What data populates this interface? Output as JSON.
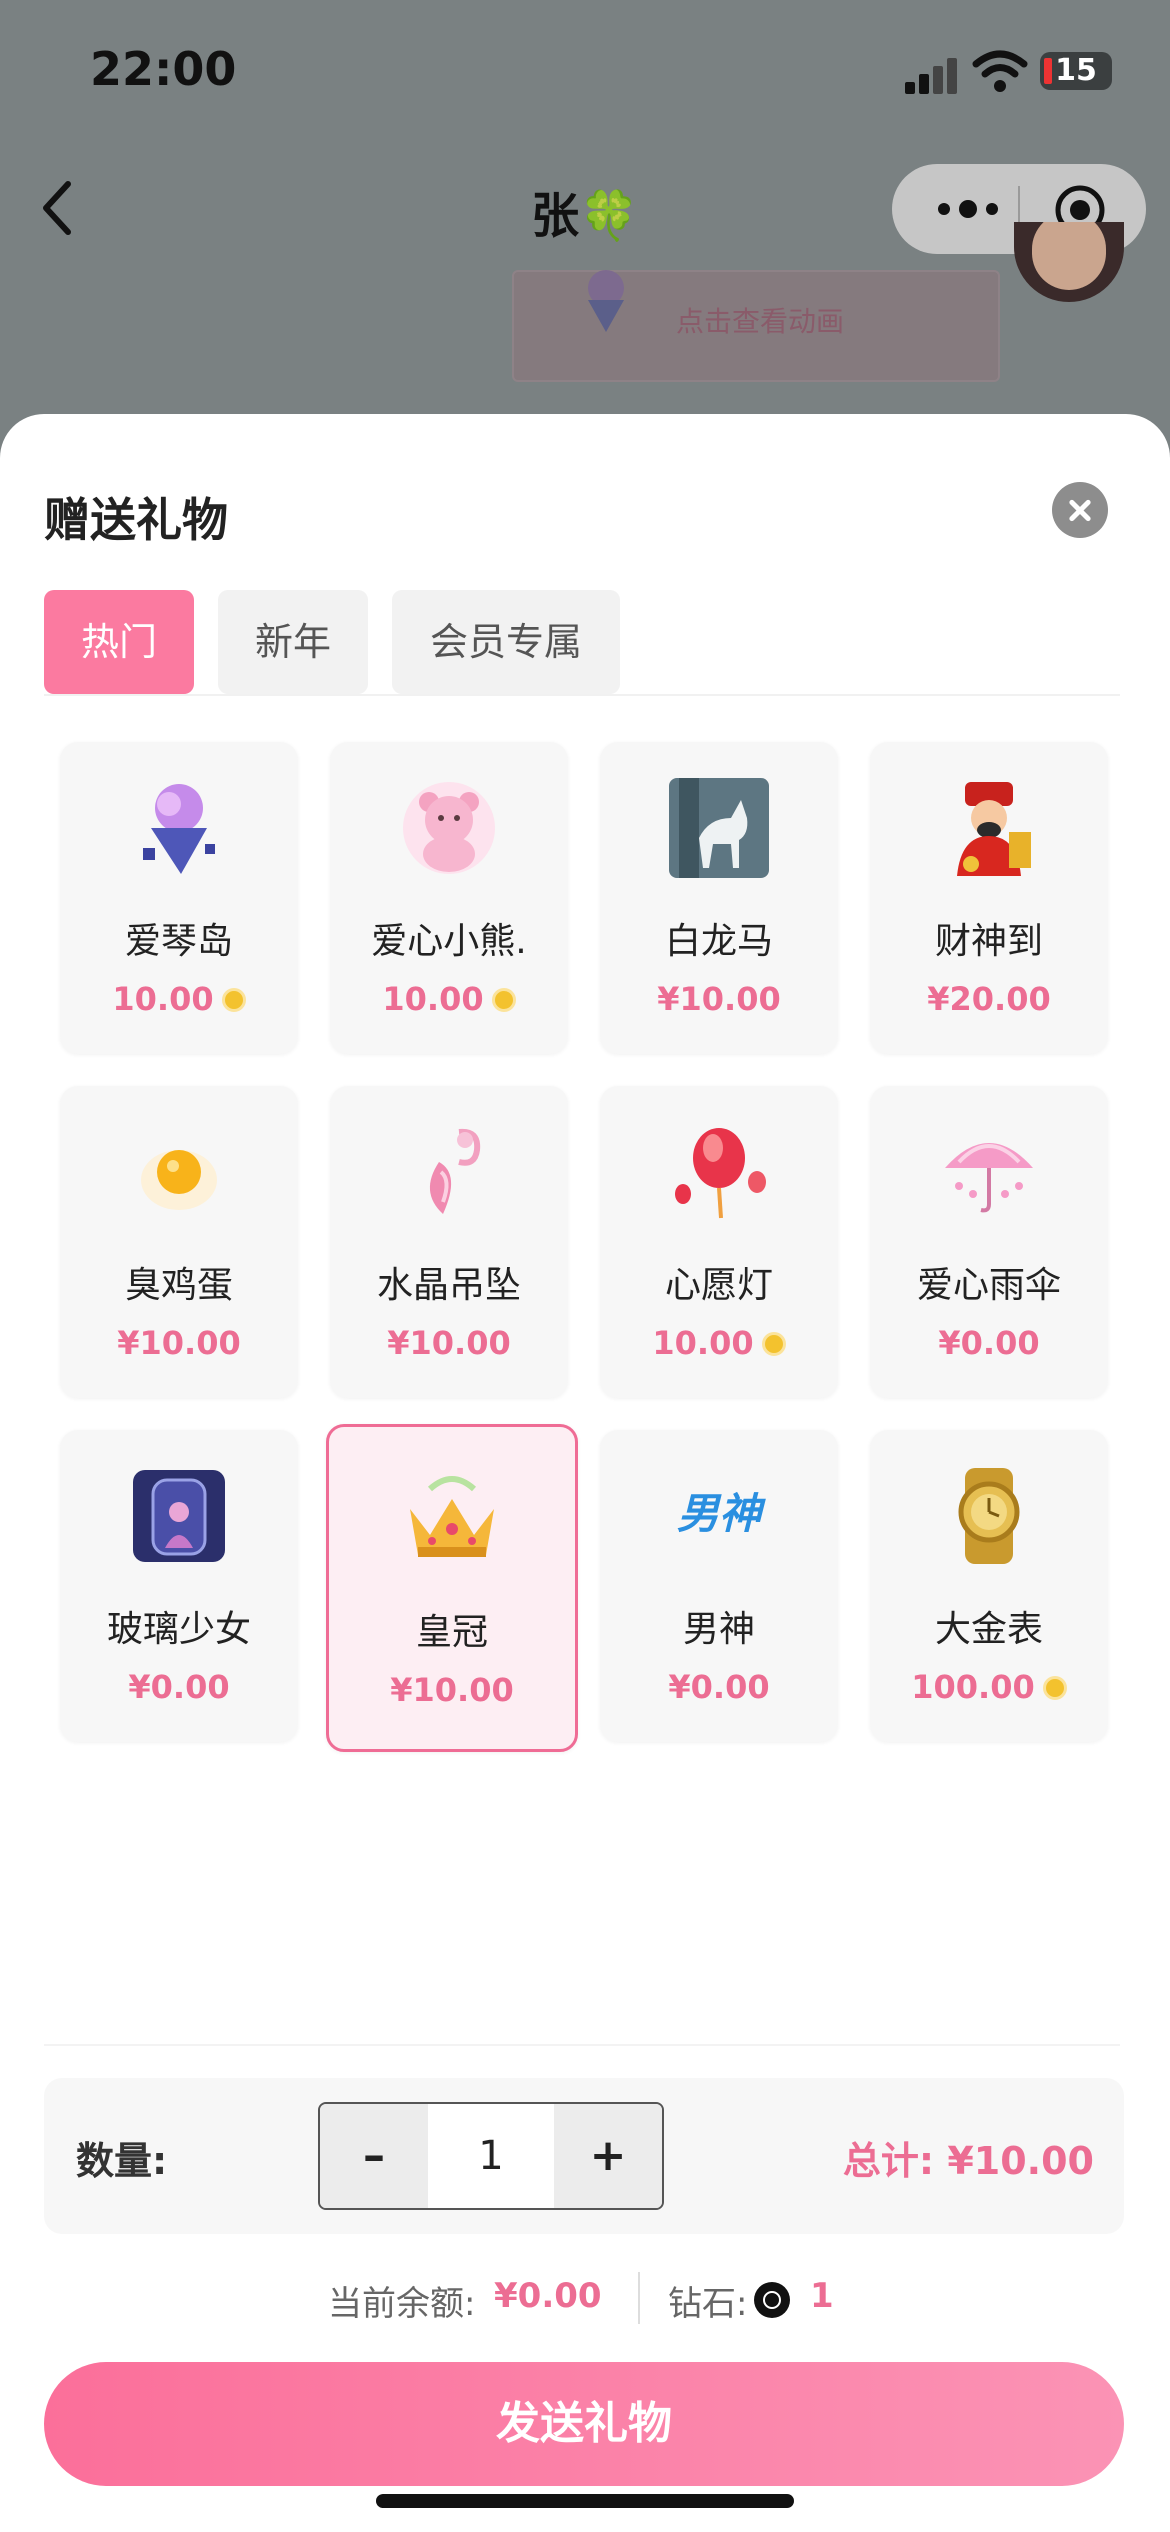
{
  "status_bar": {
    "time": "22:00",
    "battery": "15"
  },
  "nav": {
    "title": "张🍀"
  },
  "background_message": {
    "link_text": "点击查看动画"
  },
  "sheet": {
    "title": "赠送礼物",
    "tabs": [
      {
        "label": "热门",
        "active": true
      },
      {
        "label": "新年",
        "active": false
      },
      {
        "label": "会员专属",
        "active": false
      }
    ],
    "gifts": [
      {
        "name": "爱琴岛",
        "price": "10.00",
        "coin": true,
        "icon": "floating-island-icon"
      },
      {
        "name": "爱心小熊.",
        "price": "10.00",
        "coin": true,
        "icon": "teddy-bear-icon"
      },
      {
        "name": "白龙马",
        "price": "¥10.00",
        "coin": false,
        "icon": "white-horse-icon"
      },
      {
        "name": "财神到",
        "price": "¥20.00",
        "coin": false,
        "icon": "god-of-wealth-icon"
      },
      {
        "name": "臭鸡蛋",
        "price": "¥10.00",
        "coin": false,
        "icon": "egg-icon"
      },
      {
        "name": "水晶吊坠",
        "price": "¥10.00",
        "coin": false,
        "icon": "crystal-pendant-icon"
      },
      {
        "name": "心愿灯",
        "price": "10.00",
        "coin": true,
        "icon": "sky-lantern-icon"
      },
      {
        "name": "爱心雨伞",
        "price": "¥0.00",
        "coin": false,
        "icon": "umbrella-icon"
      },
      {
        "name": "玻璃少女",
        "price": "¥0.00",
        "coin": false,
        "icon": "glass-bottle-icon"
      },
      {
        "name": "皇冠",
        "price": "¥10.00",
        "coin": false,
        "icon": "crown-icon",
        "selected": true
      },
      {
        "name": "男神",
        "price": "¥0.00",
        "coin": false,
        "icon": "male-god-text-icon",
        "icon_text": "男神"
      },
      {
        "name": "大金表",
        "price": "100.00",
        "coin": true,
        "icon": "gold-watch-icon"
      }
    ],
    "quantity": {
      "label": "数量:",
      "minus": "–",
      "value": "1",
      "plus": "+"
    },
    "total": "总计: ¥10.00",
    "balance": {
      "label": "当前余额:",
      "value": "¥0.00",
      "diamond_label": "钻石:",
      "diamond_value": "1"
    },
    "send_button": "发送礼物"
  },
  "colors": {
    "accent": "#fb7aa0",
    "price": "#ec6d93"
  }
}
